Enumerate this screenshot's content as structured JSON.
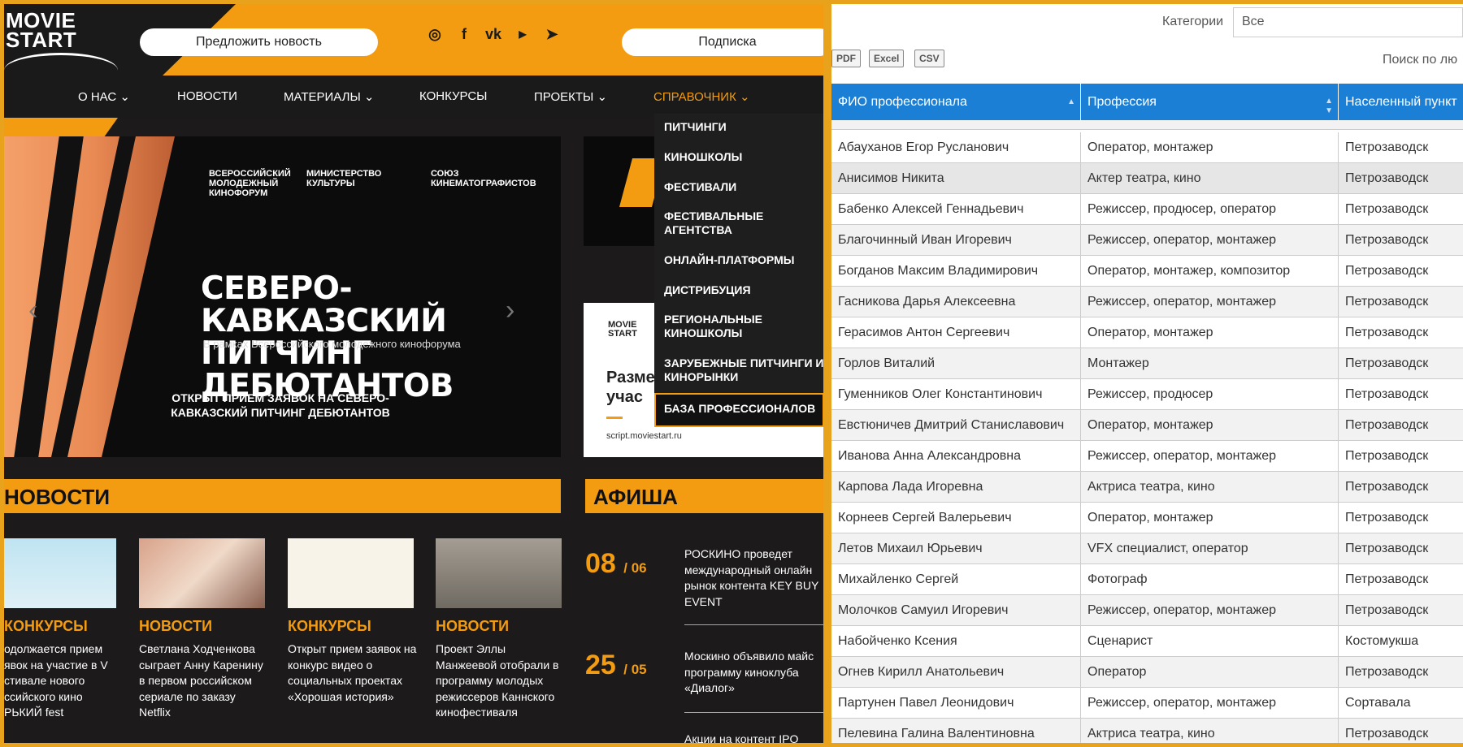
{
  "left": {
    "logo": [
      "MOVIE",
      "START"
    ],
    "suggest_button": "Предложить новость",
    "subscribe_button": "Подписка",
    "social": [
      "instagram-icon",
      "facebook-icon",
      "vk-icon",
      "youtube-icon",
      "telegram-icon"
    ],
    "nav": [
      "О НАС",
      "НОВОСТИ",
      "МАТЕРИАЛЫ",
      "КОНКУРСЫ",
      "ПРОЕКТЫ",
      "СПРАВОЧНИК"
    ],
    "dropdown": [
      "ПИТЧИНГИ",
      "КИНОШКОЛЫ",
      "ФЕСТИВАЛИ",
      "ФЕСТИВАЛЬНЫЕ АГЕНТСТВА",
      "ОНЛАЙН-ПЛАТФОРМЫ",
      "ДИСТРИБУЦИЯ",
      "РЕГИОНАЛЬНЫЕ КИНОШКОЛЫ",
      "ЗАРУБЕЖНЫЕ ПИТЧИНГИ И КИНОРЫНКИ",
      "БАЗА ПРОФЕССИОНАЛОВ"
    ],
    "hero": {
      "logo1": "ВСЕРОССИЙСКИЙ МОЛОДЕЖНЫЙ КИНОФОРУМ",
      "logo2": "МИНИСТЕРСТВО КУЛЬТУРЫ",
      "logo3": "СОЮЗ КИНЕМАТОГРАФИСТОВ",
      "title": "СЕВЕРО-КАВКАЗСКИЙ ПИТЧИНГ ДЕБЮТАНТОВ",
      "subtitle": "В рамках Всероссийского молодежного кинофорума",
      "caption": "ОТКРЫТ ПРИЕМ ЗАЯВОК НА СЕВЕРО-КАВКАЗСКИЙ ПИТЧИНГ ДЕБЮТАНТОВ"
    },
    "side_banner": {
      "logo": [
        "MOVIE",
        "START"
      ],
      "text": "Разме и учас",
      "url": "script.moviestart.ru"
    },
    "news_title": "НОВОСТИ",
    "afisha_title": "АФИША",
    "news": [
      {
        "category": "КОНКУРСЫ",
        "text": "одолжается прием явок на участие в V стивале нового ссийского кино РЬКИЙ fest"
      },
      {
        "category": "НОВОСТИ",
        "text": "Светлана Ходченкова сыграет Анну Каренину в первом российском сериале по заказу Netflix"
      },
      {
        "category": "КОНКУРСЫ",
        "text": "Открыт прием заявок на конкурс видео о социальных проектах «Хорошая история»"
      },
      {
        "category": "НОВОСТИ",
        "text": "Проект Эллы Манжеевой отобрали в программу молодых режиссеров Каннского кинофестиваля"
      }
    ],
    "afisha": [
      {
        "day": "08",
        "month": "/ 06",
        "text": "РОСКИНО проведет международный онлайн рынок контента KEY BUY EVENT"
      },
      {
        "day": "25",
        "month": "/ 05",
        "text": "Москино объявило майс программу киноклуба «Диалог»"
      },
      {
        "day": "",
        "month": "",
        "text": "Акции на контент IPO"
      }
    ]
  },
  "right": {
    "categories_label": "Категории",
    "categories_value": "Все",
    "export": [
      "PDF",
      "Excel",
      "CSV"
    ],
    "search_label": "Поиск по лю",
    "columns": [
      "ФИО профессионала",
      "Профессия",
      "Населенный пункт"
    ],
    "rows": [
      [
        "Абауханов Егор Русланович",
        "Оператор, монтажер",
        "Петрозаводск"
      ],
      [
        "Анисимов Никита",
        "Актер театра, кино",
        "Петрозаводск"
      ],
      [
        "Бабенко Алексей Геннадьевич",
        "Режиссер, продюсер, оператор",
        "Петрозаводск"
      ],
      [
        "Благочинный Иван Игоревич",
        "Режиссер, оператор, монтажер",
        "Петрозаводск"
      ],
      [
        "Богданов Максим Владимирович",
        "Оператор, монтажер, композитор",
        "Петрозаводск"
      ],
      [
        "Гасникова Дарья Алексеевна",
        "Режиссер, оператор, монтажер",
        "Петрозаводск"
      ],
      [
        "Герасимов Антон Сергеевич",
        "Оператор, монтажер",
        "Петрозаводск"
      ],
      [
        "Горлов Виталий",
        "Монтажер",
        "Петрозаводск"
      ],
      [
        "Гуменников Олег Константинович",
        "Режиссер, продюсер",
        "Петрозаводск"
      ],
      [
        "Евстюничев Дмитрий Станиславович",
        "Оператор, монтажер",
        "Петрозаводск"
      ],
      [
        "Иванова Анна Александровна",
        "Режиссер, оператор, монтажер",
        "Петрозаводск"
      ],
      [
        "Карпова Лада Игоревна",
        "Актриса театра, кино",
        "Петрозаводск"
      ],
      [
        "Корнеев Сергей Валерьевич",
        "Оператор, монтажер",
        "Петрозаводск"
      ],
      [
        "Летов Михаил Юрьевич",
        "VFX специалист, оператор",
        "Петрозаводск"
      ],
      [
        "Михайленко Сергей",
        "Фотограф",
        "Петрозаводск"
      ],
      [
        "Молочков Самуил Игоревич",
        "Режиссер, оператор, монтажер",
        "Петрозаводск"
      ],
      [
        "Набойченко Ксения",
        "Сценарист",
        "Костомукша"
      ],
      [
        "Огнев Кирилл Анатольевич",
        "Оператор",
        "Петрозаводск"
      ],
      [
        "Партунен Павел Леонидович",
        "Режиссер, оператор, монтажер",
        "Сортавала"
      ],
      [
        "Пелевина Галина Валентиновна",
        "Актриса театра, кино",
        "Петрозаводск"
      ]
    ]
  },
  "colors": {
    "accent": "#f39c12",
    "header_blue": "#1c7fd6",
    "dark": "#1c1a1b"
  }
}
